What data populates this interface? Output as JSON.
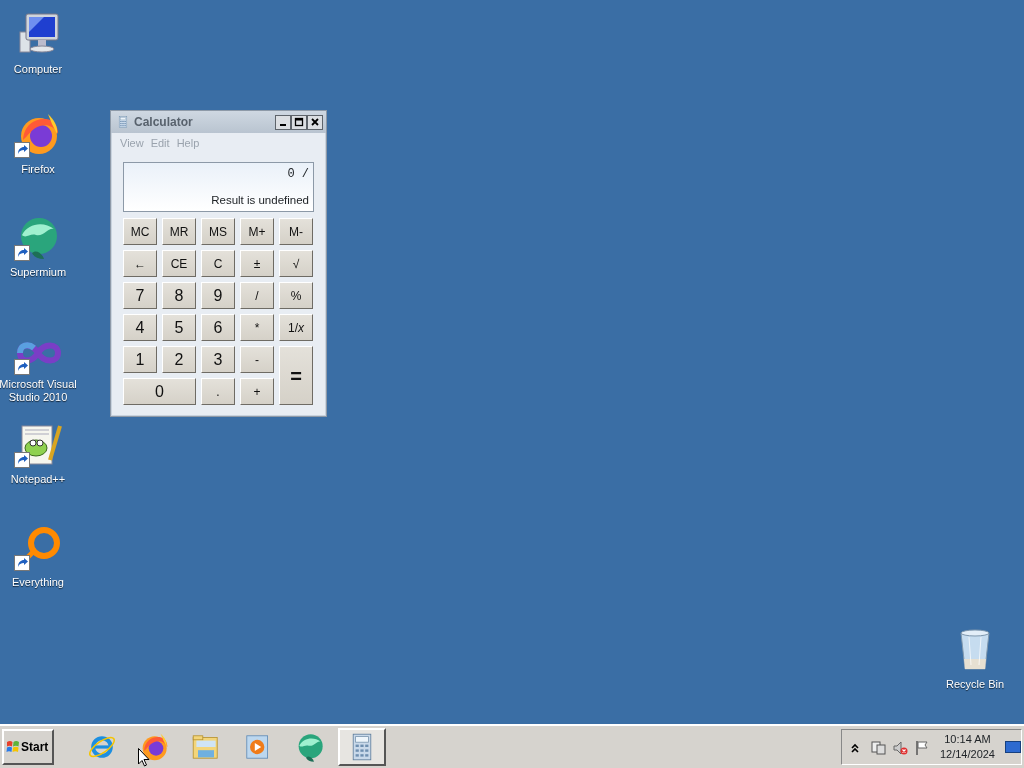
{
  "desktop_icons": [
    {
      "label": "Computer",
      "kind": "computer",
      "shortcut": false
    },
    {
      "label": "Firefox",
      "kind": "firefox",
      "shortcut": true
    },
    {
      "label": "Supermium",
      "kind": "supermium",
      "shortcut": true
    },
    {
      "label": "Microsoft Visual Studio 2010",
      "kind": "visualstudio",
      "shortcut": true
    },
    {
      "label": "Notepad++",
      "kind": "notepadpp",
      "shortcut": true
    },
    {
      "label": "Everything",
      "kind": "everything",
      "shortcut": true
    },
    {
      "label": "Recycle Bin",
      "kind": "recyclebin",
      "shortcut": false
    }
  ],
  "window": {
    "title": "Calculator",
    "active": false,
    "menu": [
      "View",
      "Edit",
      "Help"
    ],
    "display": {
      "expression": "0 /",
      "result": "Result is undefined"
    },
    "keys": [
      {
        "label": "MC",
        "kind": "normal"
      },
      {
        "label": "MR",
        "kind": "normal"
      },
      {
        "label": "MS",
        "kind": "normal"
      },
      {
        "label": "M+",
        "kind": "normal"
      },
      {
        "label": "M-",
        "kind": "normal"
      },
      {
        "label": "←",
        "kind": "normal"
      },
      {
        "label": "CE",
        "kind": "normal"
      },
      {
        "label": "C",
        "kind": "normal"
      },
      {
        "label": "±",
        "kind": "normal"
      },
      {
        "label": "√",
        "kind": "normal"
      },
      {
        "label": "7",
        "kind": "normal"
      },
      {
        "label": "8",
        "kind": "normal"
      },
      {
        "label": "9",
        "kind": "normal"
      },
      {
        "label": "/",
        "kind": "normal"
      },
      {
        "label": "%",
        "kind": "normal"
      },
      {
        "label": "4",
        "kind": "normal"
      },
      {
        "label": "5",
        "kind": "normal"
      },
      {
        "label": "6",
        "kind": "normal"
      },
      {
        "label": "*",
        "kind": "normal"
      },
      {
        "label": "1/*x*",
        "kind": "normal"
      },
      {
        "label": "1",
        "kind": "normal"
      },
      {
        "label": "2",
        "kind": "normal"
      },
      {
        "label": "3",
        "kind": "normal"
      },
      {
        "label": "-",
        "kind": "normal"
      },
      {
        "label": "=",
        "kind": "tall"
      },
      {
        "label": "0",
        "kind": "wide"
      },
      {
        "label": ".",
        "kind": "normal"
      },
      {
        "label": "+",
        "kind": "normal"
      }
    ]
  },
  "taskbar": {
    "start": "Start",
    "apps": [
      {
        "kind": "ie",
        "selected": false
      },
      {
        "kind": "firefox",
        "selected": false
      },
      {
        "kind": "explorer",
        "selected": false
      },
      {
        "kind": "mediaplayer",
        "selected": false
      },
      {
        "kind": "supermium",
        "selected": false
      },
      {
        "kind": "calculator",
        "selected": true
      }
    ],
    "clock": {
      "time": "10:14 AM",
      "date": "12/14/2024"
    }
  }
}
